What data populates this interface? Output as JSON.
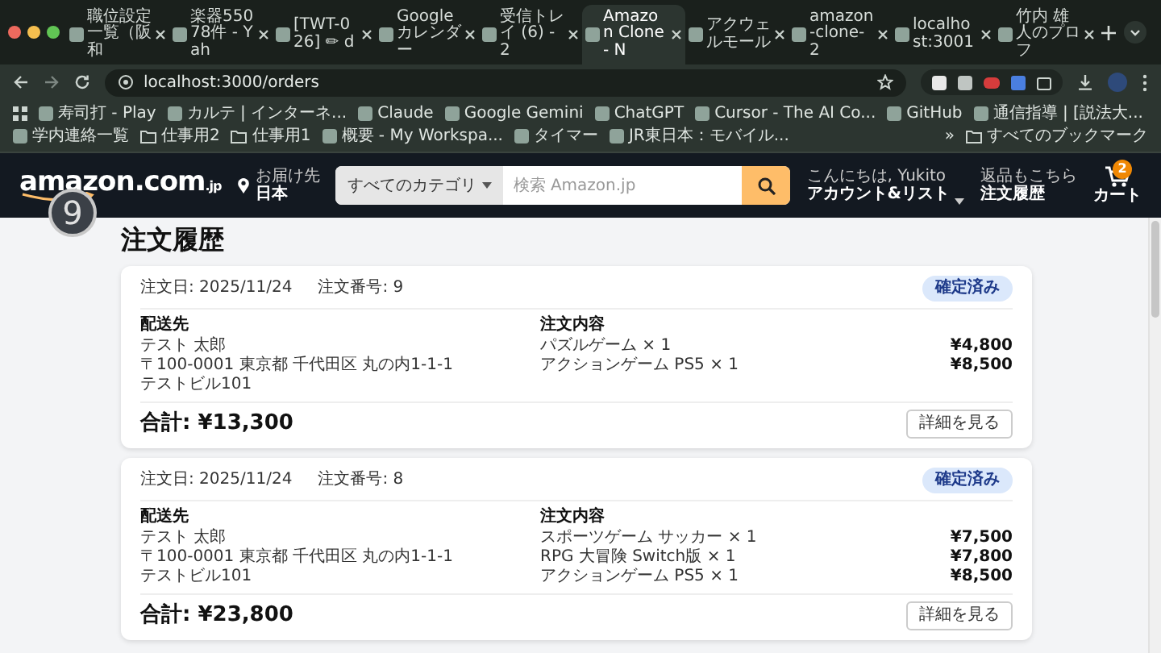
{
  "browser": {
    "tabs": [
      {
        "title": "職位設定一覧（阪和",
        "selected": false
      },
      {
        "title": "楽器55078件 - Yah",
        "selected": false
      },
      {
        "title": "[TWT-026] ✏ d",
        "selected": false
      },
      {
        "title": "Google カレンダー",
        "selected": false
      },
      {
        "title": "受信トレイ (6) - 2",
        "selected": false
      },
      {
        "title": "Amazon Clone - N",
        "selected": true
      },
      {
        "title": "アクウェルモール",
        "selected": false
      },
      {
        "title": "amazon-clone-2",
        "selected": false
      },
      {
        "title": "localhost:3001",
        "selected": false
      },
      {
        "title": "竹内 雄人のプロフ",
        "selected": false
      }
    ],
    "url": "localhost:3000/orders",
    "bookmarks": [
      {
        "title": "寿司打 - Play",
        "kind": "page"
      },
      {
        "title": "カルテ | インターネ...",
        "kind": "page"
      },
      {
        "title": "Claude",
        "kind": "page"
      },
      {
        "title": "Google Gemini",
        "kind": "page"
      },
      {
        "title": "ChatGPT",
        "kind": "page"
      },
      {
        "title": "Cursor - The AI Co...",
        "kind": "page"
      },
      {
        "title": "GitHub",
        "kind": "page"
      },
      {
        "title": "通信指導 | [説法大...",
        "kind": "page"
      },
      {
        "title": "学内連絡一覧",
        "kind": "page"
      },
      {
        "title": "仕事用2",
        "kind": "folder"
      },
      {
        "title": "仕事用1",
        "kind": "folder"
      },
      {
        "title": "概要 - My Workspa...",
        "kind": "page"
      },
      {
        "title": "タイマー",
        "kind": "page"
      },
      {
        "title": "JR東日本：モバイル...",
        "kind": "page"
      }
    ],
    "bookmarks_overflow": "»",
    "all_bookmarks": "すべてのブックマーク"
  },
  "header": {
    "logo": "amazon.com",
    "logo_suffix": ".jp",
    "overlay_badge": "9",
    "deliver_label": "お届け先",
    "deliver_value": "日本",
    "category": "すべてのカテゴリ",
    "search_placeholder": "検索 Amazon.jp",
    "greeting": "こんにちは, Yukito",
    "account": "アカウント&リスト",
    "returns_label": "返品もこちら",
    "orders": "注文履歴",
    "cart_count": "2",
    "cart": "カート"
  },
  "page": {
    "title": "注文履歴",
    "orders": [
      {
        "date": "注文日: 2025/11/24",
        "number": "注文番号: 9",
        "status": "確定済み",
        "shipping_title": "配送先",
        "shipping_lines": [
          "テスト 太郎",
          "〒100-0001 東京都 千代田区 丸の内1-1-1",
          "テストビル101"
        ],
        "items_title": "注文内容",
        "items": [
          {
            "name": "パズルゲーム × 1",
            "price": "¥4,800"
          },
          {
            "name": "アクションゲーム PS5 × 1",
            "price": "¥8,500"
          }
        ],
        "total": "合計: ¥13,300",
        "details_button": "詳細を見る"
      },
      {
        "date": "注文日: 2025/11/24",
        "number": "注文番号: 8",
        "status": "確定済み",
        "shipping_title": "配送先",
        "shipping_lines": [
          "テスト 太郎",
          "〒100-0001 東京都 千代田区 丸の内1-1-1",
          "テストビル101"
        ],
        "items_title": "注文内容",
        "items": [
          {
            "name": "スポーツゲーム サッカー × 1",
            "price": "¥7,500"
          },
          {
            "name": "RPG 大冒険 Switch版 × 1",
            "price": "¥7,800"
          },
          {
            "name": "アクションゲーム PS5 × 1",
            "price": "¥8,500"
          }
        ],
        "total": "合計: ¥23,800",
        "details_button": "詳細を見る"
      }
    ]
  }
}
